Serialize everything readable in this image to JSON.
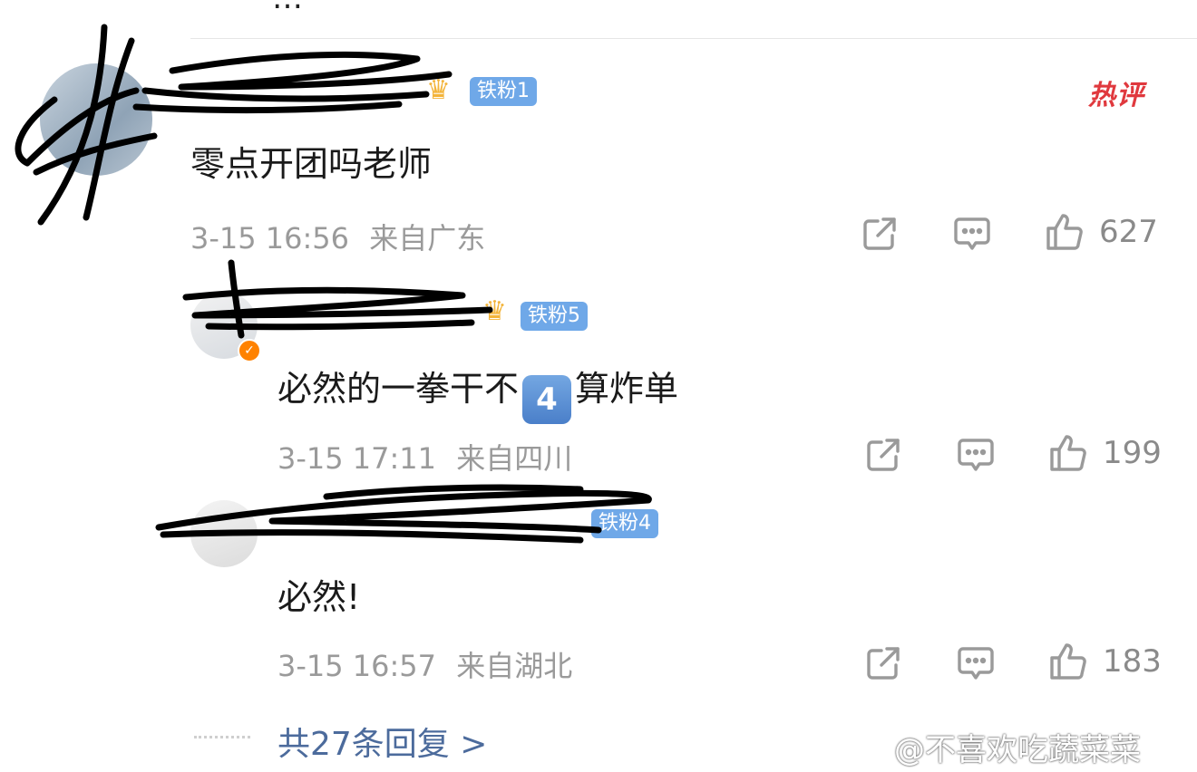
{
  "header": {
    "partial_text": "…"
  },
  "comments": [
    {
      "username": "",
      "fan_badge": "铁粉1",
      "hot_label": "热评",
      "text": "零点开团吗老师",
      "time": "3-15 16:56",
      "location": "来自广东",
      "likes": "627"
    },
    {
      "username": "",
      "fan_badge": "铁粉5",
      "text_before": "必然的一拳干不",
      "emoji": "4",
      "text_after": "算炸单",
      "time": "3-15 17:11",
      "location": "来自四川",
      "likes": "199"
    },
    {
      "username": "",
      "fan_badge": "铁粉4",
      "text": "必然!",
      "time": "3-15 16:57",
      "location": "来自湖北",
      "likes": "183"
    }
  ],
  "more_replies": "共27条回复 >",
  "watermark": "@不喜欢吃蔬菜菜",
  "icons": [
    "share-icon",
    "comment-icon",
    "like-icon",
    "crown-icon",
    "verified-icon"
  ]
}
